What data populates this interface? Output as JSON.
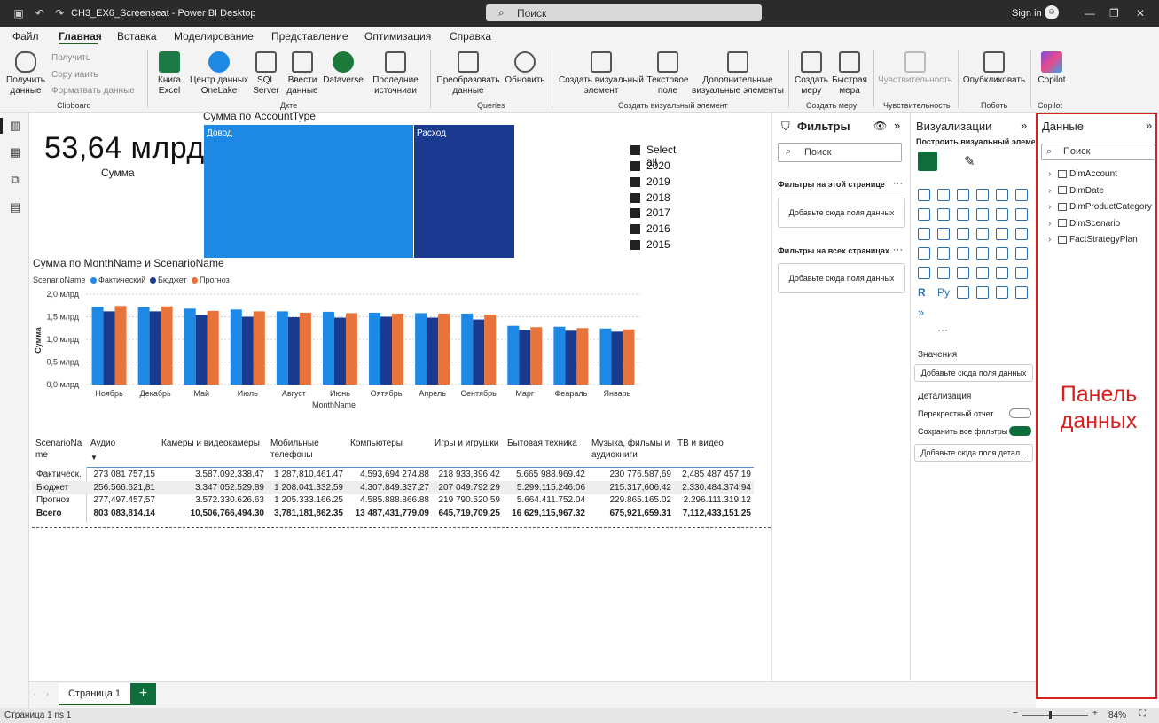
{
  "window": {
    "title": "CH3_EX6_Screenseat - Power BI Desktop",
    "search_placeholder": "Поиск",
    "signin": "Sign in"
  },
  "menu": [
    "Файл",
    "Главная",
    "Вставка",
    "Моделирование",
    "Представление",
    "Оптимизация",
    "Справка"
  ],
  "ribbon": {
    "get_data": "Получить данные",
    "recent_get": "Получить",
    "recent_copy": "Copy иаить",
    "format_data": "Форматвать данные",
    "excel": "Книга Excel",
    "onelake": "Центр данных OneLake",
    "sql": "SQL Server",
    "enter": "Ввести данные",
    "dataverse": "Dataverse",
    "recent_sources": "Последние источниаи",
    "transform": "Преобразовать данные",
    "refresh": "Обновить",
    "new_visual": "Создать визуальный элемент",
    "textbox": "Текстовое поле",
    "more_visuals": "Дополнительные визуальные элементы",
    "new_measure": "Создать меру",
    "quick_measure": "Быстрая мера",
    "sensitivity": "Чувствительность",
    "publish": "Опубкликовать",
    "copilot": "Copilot",
    "groups": {
      "clipboard": "Clipboard",
      "data": "Дкте",
      "queries": "Queries",
      "insert": "Создать визуальный элемент",
      "calc": "Создать меру",
      "sens": "Чувствительность",
      "share": "Поботь",
      "copilot": "Copilot"
    }
  },
  "kpi": {
    "value": "53,64 млрд",
    "label": "Сумма"
  },
  "treemap": {
    "title": "Сумма по AccountType",
    "income": "Довод",
    "expense": "Расход"
  },
  "slicer": [
    "Select all",
    "2020",
    "2019",
    "2018",
    "2017",
    "2016",
    "2015"
  ],
  "barchart": {
    "title": "Сумма по MonthName и ScenarioName",
    "legend_title": "ScenarioName",
    "ylabel": "Сумма",
    "xlabel": "MonthName"
  },
  "chart_data": {
    "type": "bar",
    "title": "Сумма по MonthName и ScenarioName",
    "xlabel": "MonthName",
    "ylabel": "Сумма",
    "categories": [
      "Ноябрь",
      "Декабрь",
      "Май",
      "Июль",
      "Август",
      "Июнь",
      "Оятябрь",
      "Апрель",
      "Сентябрь",
      "Марг",
      "Феараль",
      "Январь"
    ],
    "series": [
      {
        "name": "Фактический",
        "color": "#1e88e5",
        "values": [
          1.72,
          1.71,
          1.68,
          1.66,
          1.62,
          1.61,
          1.59,
          1.58,
          1.57,
          1.3,
          1.28,
          1.24
        ]
      },
      {
        "name": "Бюджет",
        "color": "#1a3a8f",
        "values": [
          1.62,
          1.62,
          1.54,
          1.5,
          1.49,
          1.48,
          1.5,
          1.48,
          1.44,
          1.21,
          1.19,
          1.17
        ]
      },
      {
        "name": "Прогноз",
        "color": "#e8743b",
        "values": [
          1.74,
          1.73,
          1.63,
          1.62,
          1.59,
          1.58,
          1.57,
          1.57,
          1.55,
          1.27,
          1.25,
          1.22
        ]
      }
    ],
    "yticks": [
      "2,0 млрд",
      "1,5 млрд",
      "1,0 млрд",
      "0,5 млрд",
      "0,0 млрд"
    ],
    "ylim": [
      0,
      2.0
    ]
  },
  "matrix": {
    "headers": [
      "ScenarioNa me",
      "Аудио",
      "Камеры и видеокамеры",
      "Мобильные телефоны",
      "Компьютеры",
      "Игры и игрушки",
      "Бытовая техника",
      "Музыка, фильмы и аудиокниги",
      "ТВ и видео"
    ],
    "rows": [
      [
        "Фактическ.",
        "273 081 757,15",
        "3.587.092,338.47",
        "1 287,810.461.47",
        "4.593,694 274.88",
        "218 933,396.42",
        "5.665 988.969.42",
        "230 776.587,69",
        "2,485 487 457,19"
      ],
      [
        "Бюджет",
        "256.566.621,81",
        "3.347 052.529.89",
        "1 208.041.332.59",
        "4.307.849.337.27",
        "207 049.792.29",
        "5.299.115.246.06",
        "215.317,606.42",
        "2.330.484.374,94"
      ],
      [
        "Прогноз",
        "277,497.457,57",
        "3.572.330.626.63",
        "1 205.333.166.25",
        "4.585.888.866.88",
        "219 790.520,59",
        "5.664.411.752.04",
        "229.865.165.02",
        "2.296.111.319,12"
      ],
      [
        "Всего",
        "803 083,814.14",
        "10,506,766,494.30",
        "3,781,181,862.35",
        "13 487,431,779.09",
        "645,719,709,25",
        "16 629,115,967.32",
        "675,921,659.31",
        "7,112,433,151.25"
      ]
    ]
  },
  "filters": {
    "title": "Фильтры",
    "search": "Поиск",
    "on_page": "Фильтры на этой странице",
    "all_pages": "Фильтры на всех страницах",
    "add": "Добавьте сюда поля данных"
  },
  "viz": {
    "title": "Визуализации",
    "build": "Построить визуальный элемен",
    "values": "Значения",
    "add_values": "Добавьте сюда поля данных",
    "drill": "Детализация",
    "cross": "Перекрестный отчет",
    "keep": "Сохранить все фильтры",
    "add_drill": "Добавьте сюда поля детал..."
  },
  "data_pane": {
    "title": "Данные",
    "search": "Поиск",
    "tables": [
      "DimAccount",
      "DimDate",
      "DimProductCategory",
      "DimScenario",
      "FactStrategyPlan"
    ]
  },
  "annotation": "Панель данных",
  "page": {
    "tab": "Страница 1",
    "status": "Страница 1 ns 1",
    "zoom": "84%"
  }
}
